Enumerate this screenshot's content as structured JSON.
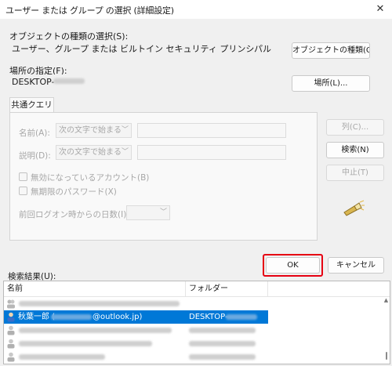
{
  "window": {
    "title": "ユーザー または グループ の選択 (詳細設定)",
    "close_glyph": "✕"
  },
  "object_types": {
    "label": "オブジェクトの種類の選択(S):",
    "value": "ユーザー、グループ または ビルトイン セキュリティ プリンシパル",
    "button": "オブジェクトの種類(O)..."
  },
  "location": {
    "label": "場所の指定(F):",
    "value": "DESKTOP-",
    "button": "場所(L)..."
  },
  "common_queries": {
    "tab": "共通クエリ",
    "name_label": "名前(A):",
    "name_mode": "次の文字で始まる",
    "desc_label": "説明(D):",
    "desc_mode": "次の文字で始まる",
    "disabled_accounts": "無効になっているアカウント(B)",
    "non_expiring_pw": "無期限のパスワード(X)",
    "days_label": "前回ログオン時からの日数(I):"
  },
  "side_buttons": {
    "columns": "列(C)...",
    "search": "検索(N)",
    "stop": "中止(T)"
  },
  "actions": {
    "ok": "OK",
    "cancel": "キャンセル"
  },
  "results": {
    "label": "検索結果(U):",
    "columns": {
      "name": "名前",
      "folder": "フォルダー"
    },
    "rows": [
      {
        "name_prefix": "秋葉一郎 (",
        "name_suffix": "@outlook.jp)",
        "folder": "DESKTOP-",
        "selected": true
      }
    ]
  },
  "colors": {
    "selection": "#0078d7",
    "highlight": "#e60012"
  }
}
